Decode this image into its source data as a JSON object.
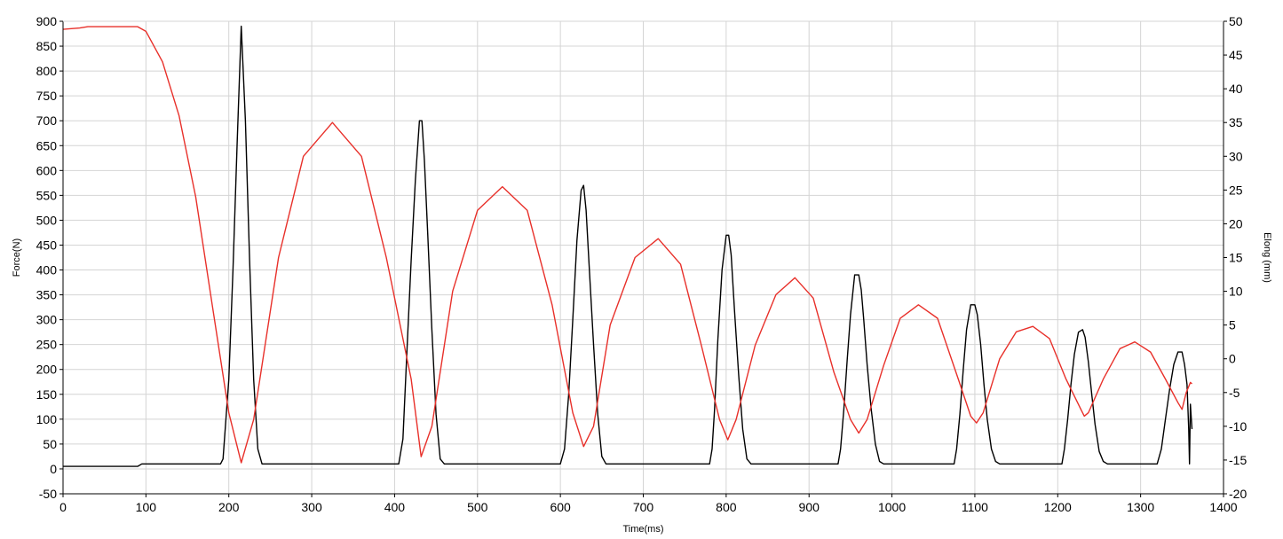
{
  "chart_data": {
    "type": "line",
    "xlabel": "Time(ms)",
    "ylabel_left": "Force(N)",
    "ylabel_right": "Elong (mm)",
    "xlim": [
      0,
      1400
    ],
    "ylim_left": [
      -50,
      900
    ],
    "ylim_right": [
      -20,
      50
    ],
    "x_ticks": [
      "0",
      "100",
      "200",
      "300",
      "400",
      "500",
      "600",
      "700",
      "800",
      "900",
      "1000",
      "1100",
      "1200",
      "1300",
      "1400"
    ],
    "y_left_ticks": [
      "-50",
      "0",
      "50",
      "100",
      "150",
      "200",
      "250",
      "300",
      "350",
      "400",
      "450",
      "500",
      "550",
      "600",
      "650",
      "700",
      "750",
      "800",
      "850",
      "900"
    ],
    "y_right_ticks": [
      "-20",
      "-15",
      "-10",
      "-5",
      "0",
      "5",
      "10",
      "15",
      "20",
      "25",
      "30",
      "35",
      "40",
      "45",
      "50"
    ],
    "grid": true,
    "colors": {
      "force": "#000000",
      "elong": "#e8302a",
      "grid": "#d4d4d4"
    },
    "series": [
      {
        "axis": "left",
        "color": "#000000",
        "x": [
          0,
          90,
          95,
          190,
          193,
          200,
          205,
          210,
          215,
          220,
          225,
          230,
          235,
          240,
          245,
          300,
          405,
          410,
          415,
          420,
          425,
          430,
          433,
          436,
          440,
          445,
          450,
          455,
          460,
          600,
          605,
          610,
          615,
          620,
          625,
          628,
          631,
          635,
          640,
          645,
          650,
          655,
          780,
          783,
          786,
          790,
          795,
          800,
          803,
          806,
          810,
          815,
          820,
          825,
          830,
          935,
          938,
          942,
          946,
          950,
          955,
          960,
          963,
          966,
          970,
          975,
          980,
          985,
          990,
          1075,
          1078,
          1082,
          1086,
          1090,
          1095,
          1100,
          1103,
          1107,
          1111,
          1115,
          1120,
          1125,
          1130,
          1205,
          1208,
          1212,
          1216,
          1220,
          1225,
          1230,
          1233,
          1237,
          1241,
          1245,
          1250,
          1255,
          1260,
          1320,
          1325,
          1330,
          1335,
          1340,
          1345,
          1350,
          1353,
          1356,
          1358,
          1359,
          1360,
          1362
        ],
        "y": [
          5,
          5,
          10,
          10,
          20,
          180,
          400,
          650,
          890,
          700,
          420,
          180,
          40,
          10,
          10,
          10,
          10,
          60,
          240,
          420,
          580,
          700,
          700,
          620,
          470,
          280,
          110,
          20,
          10,
          10,
          40,
          150,
          300,
          460,
          560,
          570,
          520,
          400,
          250,
          110,
          25,
          10,
          10,
          40,
          120,
          260,
          400,
          470,
          470,
          430,
          320,
          190,
          80,
          20,
          10,
          10,
          40,
          120,
          220,
          310,
          390,
          390,
          360,
          300,
          210,
          120,
          50,
          15,
          10,
          10,
          40,
          110,
          200,
          280,
          330,
          330,
          310,
          250,
          170,
          100,
          40,
          15,
          10,
          10,
          40,
          100,
          170,
          230,
          275,
          280,
          265,
          215,
          150,
          90,
          35,
          15,
          10,
          10,
          40,
          100,
          160,
          210,
          235,
          235,
          210,
          170,
          80,
          10,
          130,
          80
        ]
      },
      {
        "axis": "right",
        "color": "#e8302a",
        "x": [
          0,
          20,
          30,
          90,
          100,
          120,
          140,
          160,
          180,
          200,
          215,
          230,
          260,
          290,
          325,
          360,
          390,
          420,
          432,
          445,
          470,
          500,
          530,
          560,
          590,
          615,
          628,
          640,
          660,
          690,
          718,
          745,
          770,
          792,
          802,
          812,
          835,
          860,
          883,
          905,
          930,
          950,
          960,
          970,
          990,
          1010,
          1032,
          1055,
          1080,
          1095,
          1102,
          1110,
          1130,
          1150,
          1170,
          1190,
          1210,
          1228,
          1232,
          1237,
          1255,
          1275,
          1293,
          1312,
          1330,
          1345,
          1350,
          1355,
          1360,
          1362
        ],
        "y": [
          48.8,
          49,
          49.2,
          49.2,
          48.5,
          44,
          36,
          24,
          8,
          -8,
          -15.4,
          -9,
          15,
          30,
          35,
          30,
          15,
          -3,
          -14.5,
          -10,
          10,
          22,
          25.5,
          22,
          8,
          -8,
          -13,
          -10,
          5,
          15,
          17.8,
          14,
          2,
          -9,
          -12,
          -9,
          2,
          9.5,
          12,
          9,
          -2,
          -9,
          -11,
          -9,
          -1,
          6,
          8,
          6,
          -3,
          -8.5,
          -9.5,
          -8,
          0,
          4,
          4.8,
          3,
          -3,
          -7.5,
          -8.5,
          -8,
          -3,
          1.5,
          2.5,
          1,
          -3,
          -6.5,
          -7.5,
          -5,
          -3.5,
          -3.7
        ]
      }
    ]
  }
}
